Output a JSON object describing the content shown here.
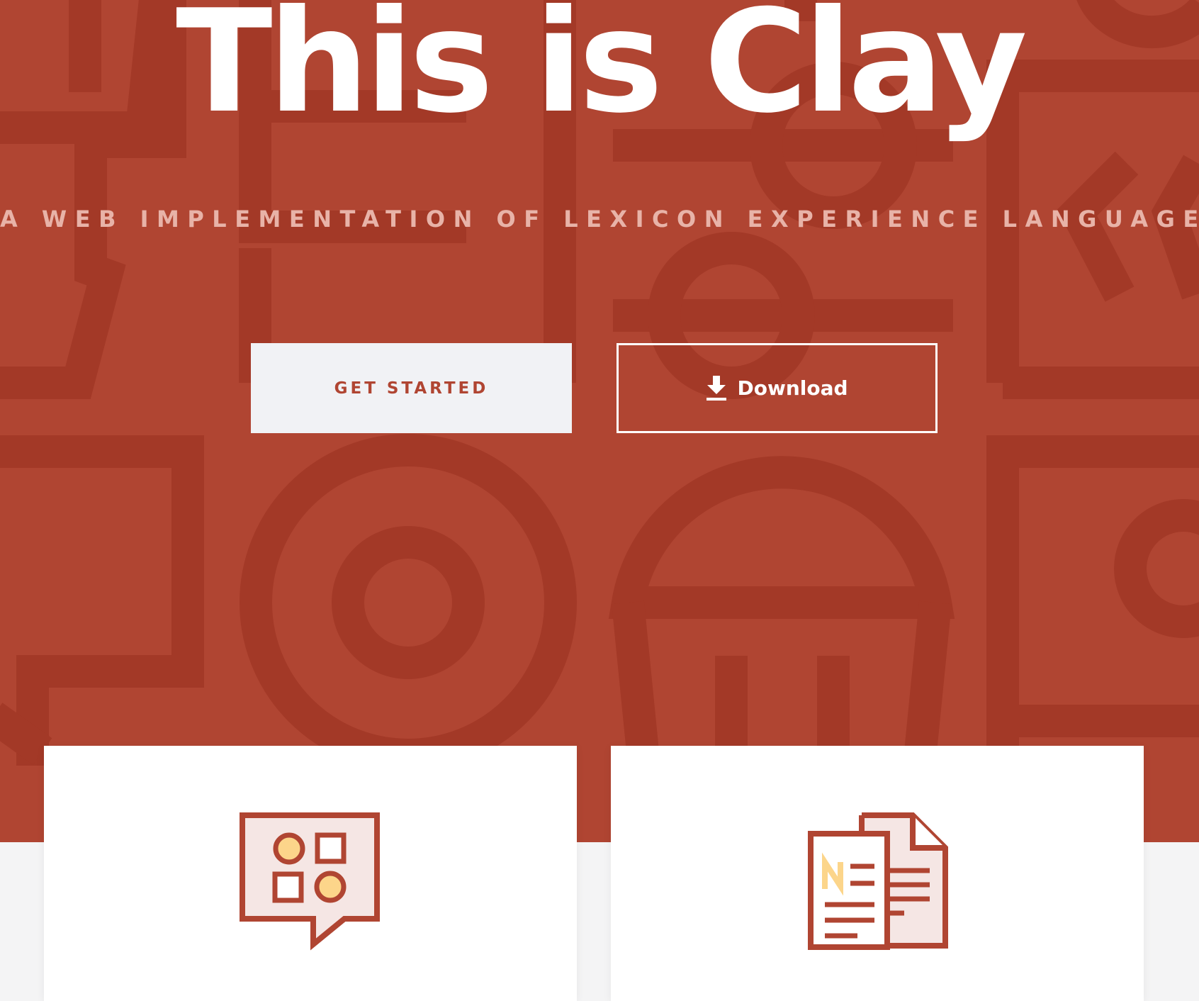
{
  "hero": {
    "title": "This is Clay",
    "subtitle": "A WEB IMPLEMENTATION OF LEXICON EXPERIENCE LANGUAGE",
    "background_color": "#b04532",
    "pattern_color": "#a33927"
  },
  "actions": {
    "get_started_label": "GET STARTED",
    "download_label": "Download",
    "download_icon": "download-icon"
  },
  "cards": [
    {
      "icon": "components-chat-icon"
    },
    {
      "icon": "documents-icon"
    }
  ],
  "colors": {
    "accent": "#b04532",
    "highlight": "#fcd58a",
    "icon_fill": "#f5e6e4",
    "page_bg": "#f4f4f5"
  }
}
